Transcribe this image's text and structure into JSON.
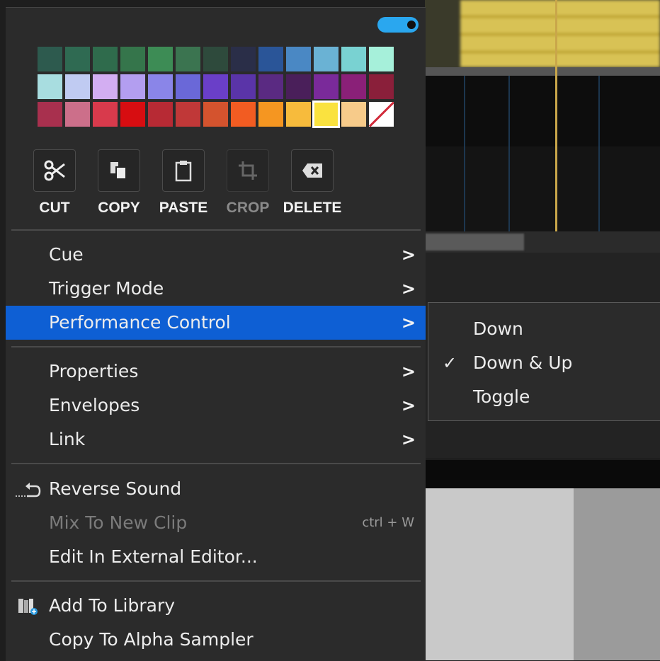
{
  "toggle": {
    "state": "on",
    "color": "#2aa7ef"
  },
  "palette": {
    "rows": [
      [
        "#2d5a4e",
        "#2f6a52",
        "#2f6b4c",
        "#35754b",
        "#3d8c55",
        "#3b7450",
        "#2e4a3c",
        "#2a2e48",
        "#2a5598",
        "#4a88c4",
        "#6ab2d4",
        "#79d2d2",
        "#a6f0da"
      ],
      [
        "#a8dde0",
        "#c0cbf2",
        "#d3aef2",
        "#b39ef0",
        "#8a85e8",
        "#6a68d8",
        "#6a3fc8",
        "#5a34a8",
        "#5a2a82",
        "#4a1f5a",
        "#7a2a9a",
        "#8a2078",
        "#8a1f3a"
      ],
      [
        "#a8304e",
        "#cc6f8a",
        "#d83a4c",
        "#d70d11",
        "#b72a34",
        "#c03838",
        "#d4532e",
        "#f25c22",
        "#f59621",
        "#f7bb3c",
        "#fae23f",
        "#f7cb8a",
        "none"
      ]
    ],
    "selected": "#fae23f"
  },
  "toolbar": {
    "cut": "CUT",
    "copy": "COPY",
    "paste": "PASTE",
    "crop": "CROP",
    "delete": "DELETE"
  },
  "menu": {
    "cue": "Cue",
    "trigger_mode": "Trigger Mode",
    "performance_control": "Performance Control",
    "properties": "Properties",
    "envelopes": "Envelopes",
    "link": "Link",
    "reverse_sound": "Reverse Sound",
    "mix_to_new_clip": "Mix To New Clip",
    "mix_shortcut": "ctrl + W",
    "edit_external": "Edit In External Editor...",
    "add_to_library": "Add To Library",
    "copy_to_alpha": "Copy To Alpha Sampler",
    "arrow": ">"
  },
  "submenu": {
    "items": [
      "Down",
      "Down & Up",
      "Toggle"
    ],
    "checked": "Down & Up",
    "check_mark": "✓"
  },
  "colors": {
    "highlight": "#0e5fd4",
    "menu_bg": "#2b2b2b",
    "disabled_text": "#7b7b7b"
  }
}
